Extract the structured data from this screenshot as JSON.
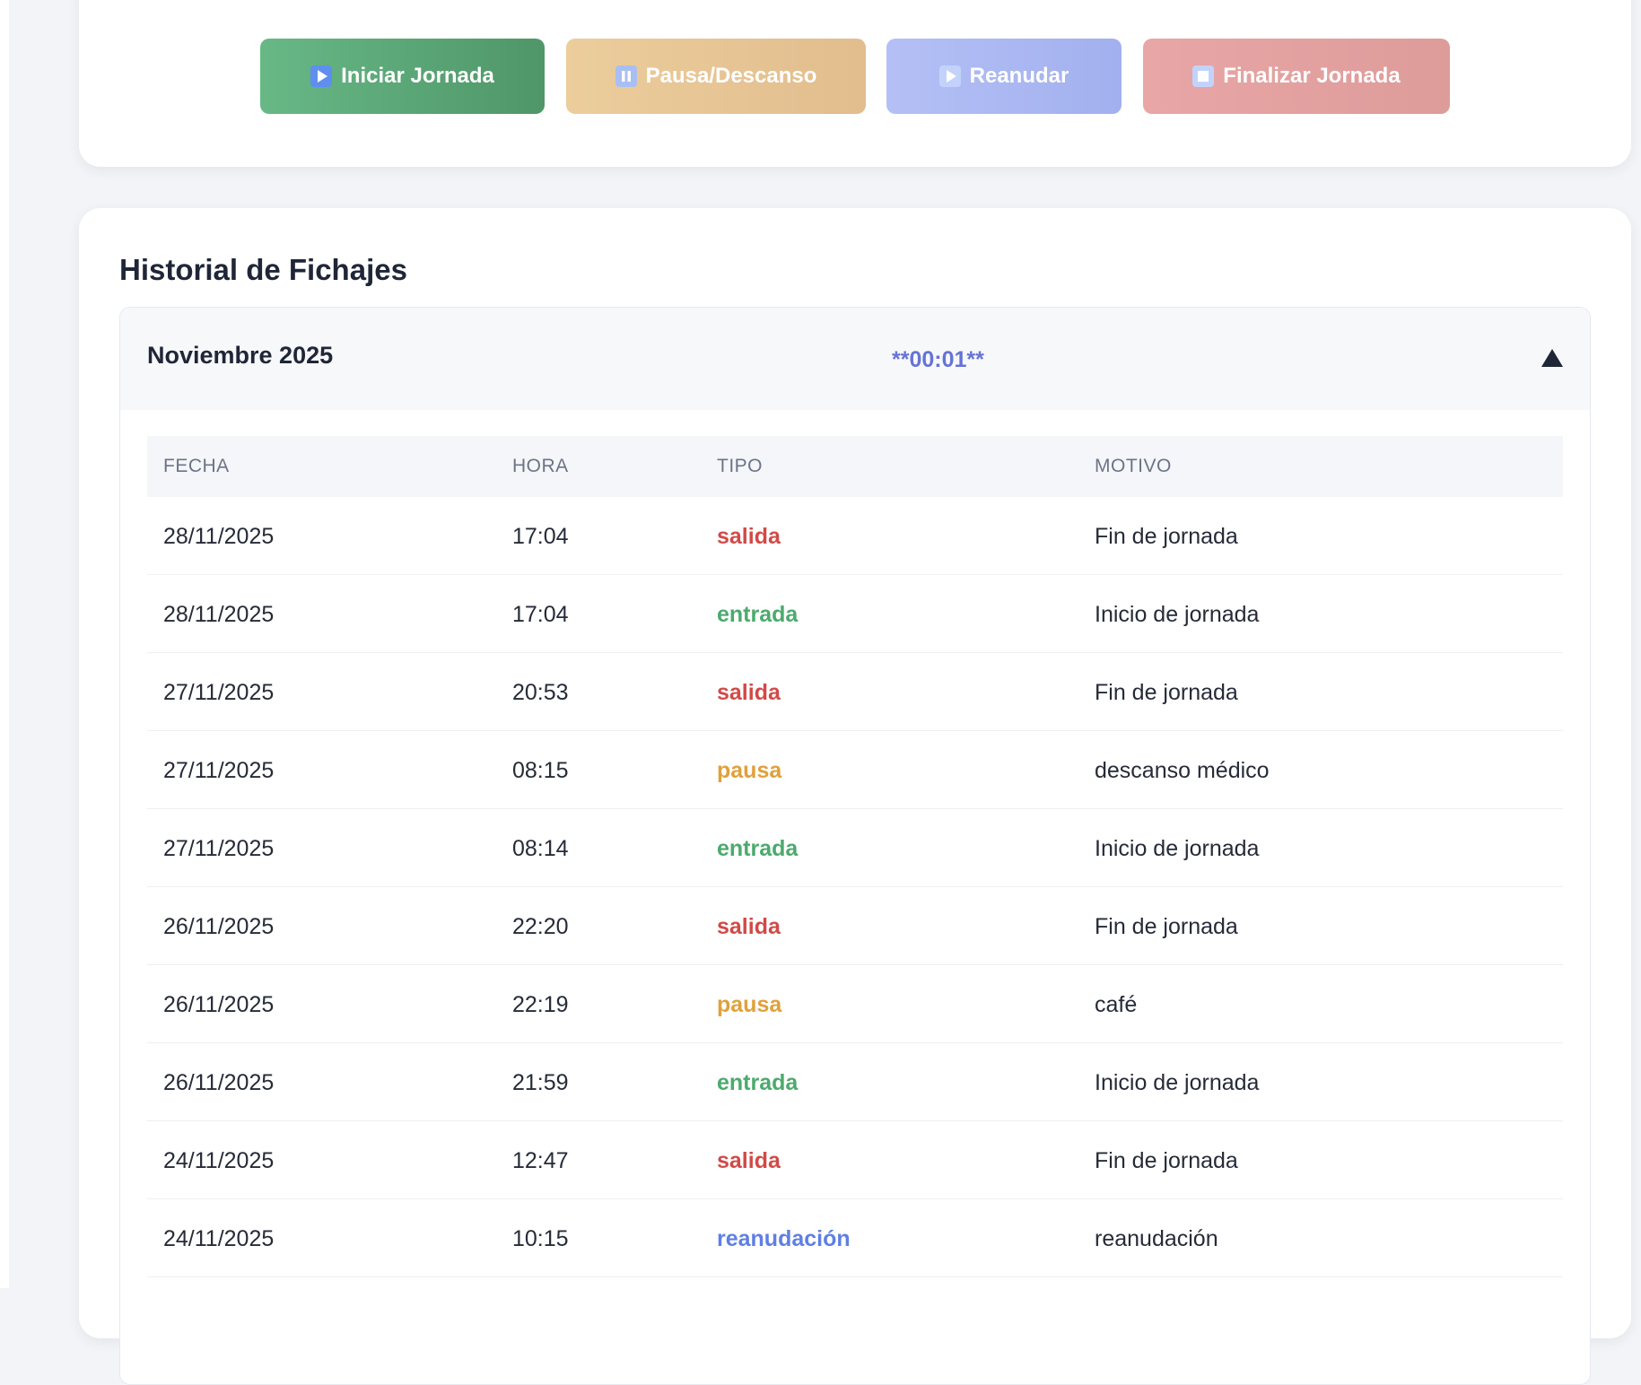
{
  "actions": {
    "start_label": "Iniciar Jornada",
    "pause_label": "Pausa/Descanso",
    "resume_label": "Reanudar",
    "finish_label": "Finalizar Jornada"
  },
  "history": {
    "title": "Historial de Fichajes",
    "month": {
      "name": "Noviembre 2025",
      "total": "**00:01**",
      "expanded": true
    },
    "columns": [
      "FECHA",
      "HORA",
      "TIPO",
      "MOTIVO"
    ],
    "rows": [
      {
        "fecha": "28/11/2025",
        "hora": "17:04",
        "tipo": "salida",
        "motivo": "Fin de jornada"
      },
      {
        "fecha": "28/11/2025",
        "hora": "17:04",
        "tipo": "entrada",
        "motivo": "Inicio de jornada"
      },
      {
        "fecha": "27/11/2025",
        "hora": "20:53",
        "tipo": "salida",
        "motivo": "Fin de jornada"
      },
      {
        "fecha": "27/11/2025",
        "hora": "08:15",
        "tipo": "pausa",
        "motivo": "descanso médico"
      },
      {
        "fecha": "27/11/2025",
        "hora": "08:14",
        "tipo": "entrada",
        "motivo": "Inicio de jornada"
      },
      {
        "fecha": "26/11/2025",
        "hora": "22:20",
        "tipo": "salida",
        "motivo": "Fin de jornada"
      },
      {
        "fecha": "26/11/2025",
        "hora": "22:19",
        "tipo": "pausa",
        "motivo": "café"
      },
      {
        "fecha": "26/11/2025",
        "hora": "21:59",
        "tipo": "entrada",
        "motivo": "Inicio de jornada"
      },
      {
        "fecha": "24/11/2025",
        "hora": "12:47",
        "tipo": "salida",
        "motivo": "Fin de jornada"
      },
      {
        "fecha": "24/11/2025",
        "hora": "10:15",
        "tipo": "reanudación",
        "motivo": "reanudación"
      }
    ]
  },
  "colors": {
    "salida": "#d14a47",
    "entrada": "#4caa6d",
    "pausa": "#e0a13a",
    "reanudacion": "#5f7fe3",
    "accent": "#6673d6"
  },
  "icons": {
    "start": "play-icon",
    "pause": "pause-icon",
    "resume": "play-icon",
    "finish": "stop-icon",
    "collapse": "triangle-up-icon"
  }
}
